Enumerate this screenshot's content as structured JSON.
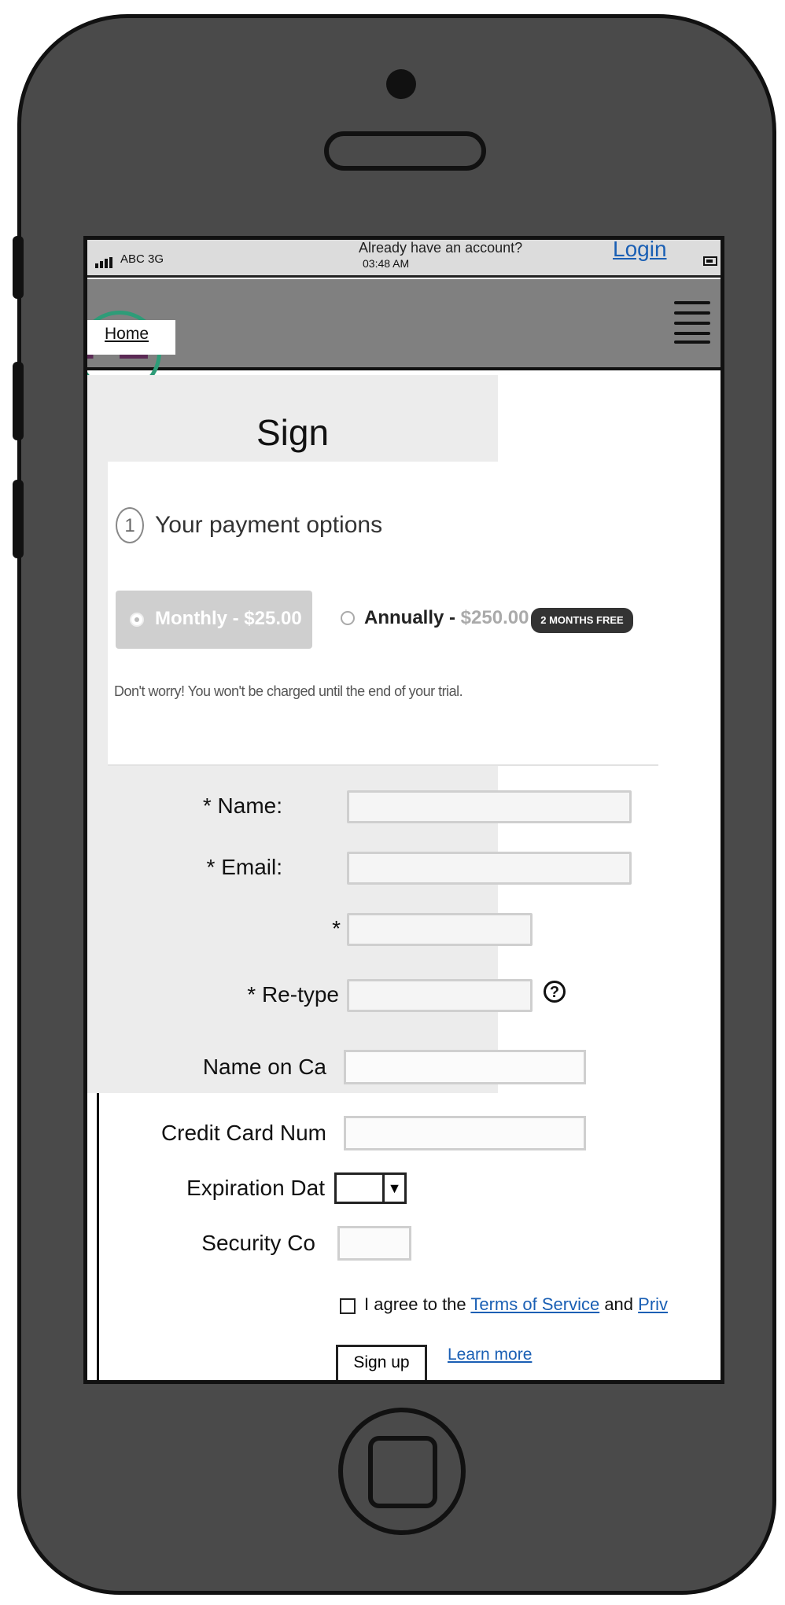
{
  "status_bar": {
    "carrier": "ABC 3G",
    "time": "03:48 AM",
    "already_text": "Already have an account?",
    "login_label": "Login"
  },
  "nav": {
    "logo_text": "PE",
    "home_label": "Home"
  },
  "page": {
    "title": "Sign"
  },
  "payment": {
    "step_number": "1",
    "heading": "Your payment options",
    "monthly_label": "Monthly - $25.00",
    "annual_label": "Annually - ",
    "annual_price": "$250.00",
    "badge": "2 MONTHS FREE",
    "trial_note": "Don't worry! You won't be charged until the end of your trial.",
    "selected": "monthly"
  },
  "form": {
    "name_label": "* Name:",
    "email_label": "* Email:",
    "password_label": "*",
    "retype_label": "* Re-type",
    "card_name_label": "Name on Ca",
    "card_number_label": "Credit Card Num",
    "expiration_label": "Expiration Dat",
    "security_label": "Security Co",
    "help_icon_glyph": "?",
    "select_arrow_glyph": "▼",
    "agree_prefix": "I agree to the ",
    "terms_link": "Terms of Service",
    "agree_and": " and ",
    "privacy_link": "Priv",
    "signup_label": "Sign up",
    "learn_more_label": "Learn more"
  },
  "colors": {
    "phone_body": "#4a4a4a",
    "nav_bar": "#808080",
    "link": "#1a5fb4",
    "logo": "#5b2a55",
    "logo_ring": "#2e9c78"
  }
}
